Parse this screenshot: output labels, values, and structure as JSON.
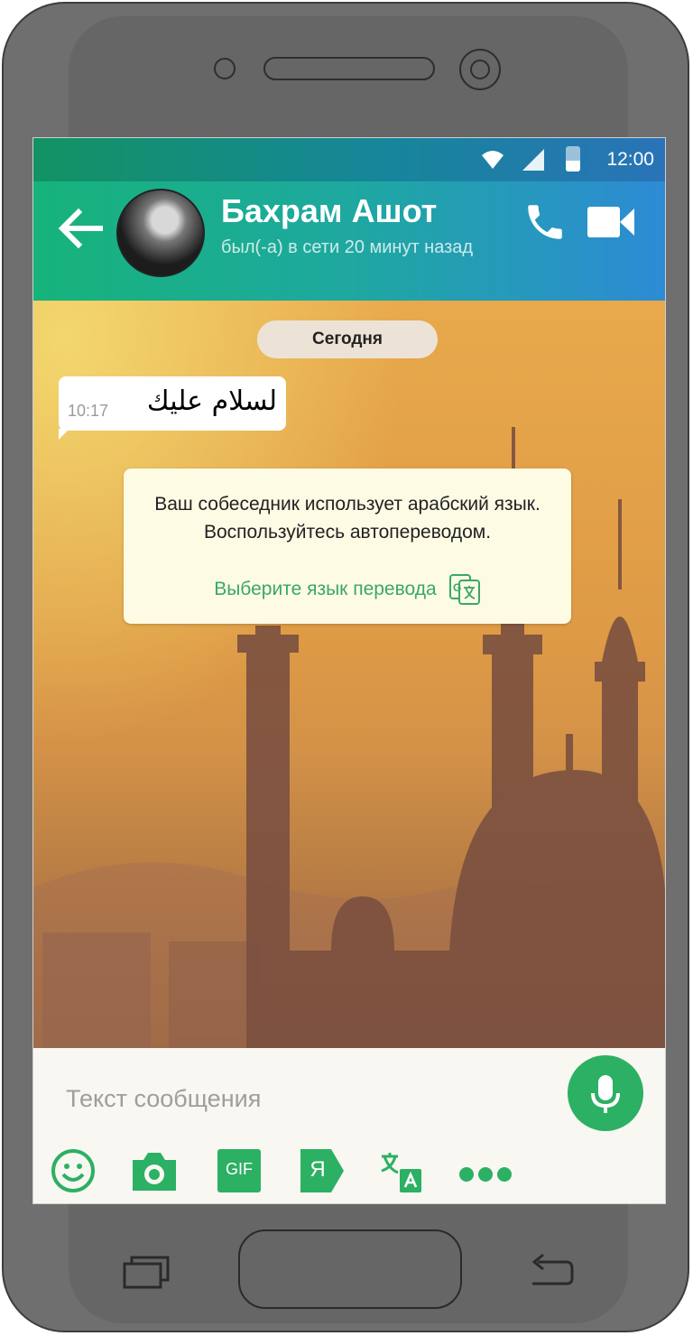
{
  "status_bar": {
    "time": "12:00"
  },
  "header": {
    "contact_name": "Бахрам Ашот",
    "last_seen": "был(-а) в сети 20 минут назад"
  },
  "chat": {
    "date_label": "Сегодня",
    "messages": [
      {
        "time": "10:17",
        "text": "لسلام عليك",
        "direction": "incoming"
      }
    ]
  },
  "translate_prompt": {
    "message": "Ваш собеседник использует арабский язык. Воспользуйтесь автопереводом.",
    "link_label": "Выберите язык перевода"
  },
  "composer": {
    "placeholder": "Текст сообщения",
    "gif_label": "GIF",
    "yandex_label": "Я"
  },
  "colors": {
    "accent_green": "#2cb063",
    "header_start": "#16b37a",
    "header_end": "#2d8bd5",
    "prompt_bg": "#fdfbe4",
    "link_green": "#3aa866"
  },
  "icons": [
    "back-arrow-icon",
    "phone-icon",
    "video-camera-icon",
    "google-translate-icon",
    "microphone-icon",
    "emoji-icon",
    "camera-icon",
    "gif-icon",
    "yandex-icon",
    "translate-icon",
    "more-icon",
    "recent-apps-icon",
    "back-nav-icon",
    "wifi-icon",
    "signal-icon",
    "battery-icon"
  ]
}
